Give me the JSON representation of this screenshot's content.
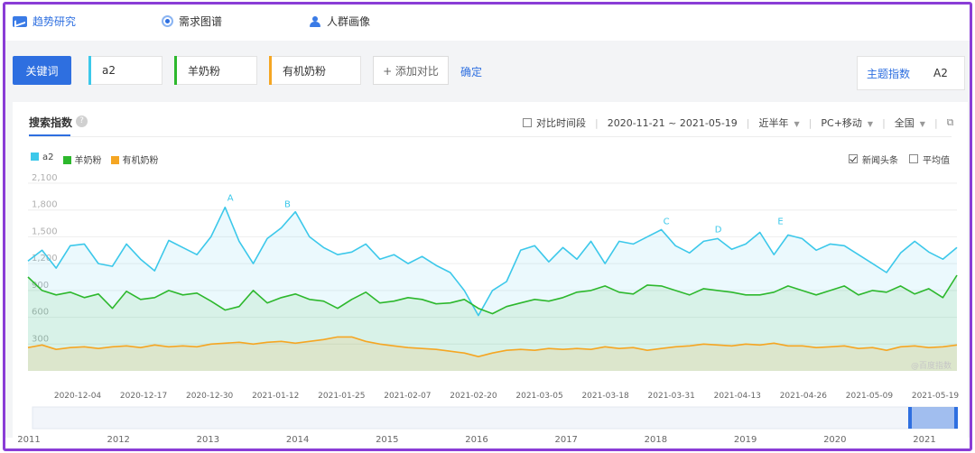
{
  "nav": {
    "trend_research": "趋势研究",
    "demand_map": "需求图谱",
    "crowd_profile": "人群画像"
  },
  "keywords": {
    "button_label": "关键词",
    "items": [
      {
        "text": "a2",
        "color": "#3cc8ea"
      },
      {
        "text": "羊奶粉",
        "color": "#2db82d"
      },
      {
        "text": "有机奶粉",
        "color": "#f5a623"
      }
    ],
    "add_compare": "+ 添加对比",
    "confirm": "确定"
  },
  "topic_index": {
    "label": "主题指数",
    "value": "A2"
  },
  "panel": {
    "title": "搜索指数",
    "compare_period": "对比时间段",
    "date_range": "2020-11-21 ~ 2021-05-19",
    "range_option": "近半年",
    "device": "PC+移动",
    "region": "全国"
  },
  "legend": [
    {
      "name": "a2",
      "color": "#3cc8ea"
    },
    {
      "name": "羊奶粉",
      "color": "#2db82d"
    },
    {
      "name": "有机奶粉",
      "color": "#f5a623"
    }
  ],
  "options": {
    "news_headlines": "新闻头条",
    "average": "平均值"
  },
  "watermark": "@百度指数",
  "chart_data": {
    "type": "line",
    "ylim": [
      0,
      2100
    ],
    "yticks": [
      "300",
      "600",
      "900",
      "1,200",
      "1,500",
      "1,800",
      "2,100"
    ],
    "yticks_values": [
      300,
      600,
      900,
      1200,
      1500,
      1800,
      2100
    ],
    "x_labels": [
      "2020-12-04",
      "2020-12-17",
      "2020-12-30",
      "2021-01-12",
      "2021-01-25",
      "2021-02-07",
      "2021-02-20",
      "2021-03-05",
      "2021-03-18",
      "2021-03-31",
      "2021-04-13",
      "2021-04-26",
      "2021-05-09",
      "2021-05-19"
    ],
    "annotations": [
      {
        "label": "A",
        "date": "2020-12-30",
        "value": 1820
      },
      {
        "label": "B",
        "date": "2021-01-10",
        "value": 1750
      },
      {
        "label": "C",
        "date": "2021-03-24",
        "value": 1560
      },
      {
        "label": "D",
        "date": "2021-04-03",
        "value": 1470
      },
      {
        "label": "E",
        "date": "2021-04-15",
        "value": 1560
      }
    ],
    "series": [
      {
        "name": "a2",
        "color": "#3cc8ea",
        "values": [
          1230,
          1350,
          1150,
          1400,
          1420,
          1200,
          1170,
          1420,
          1250,
          1120,
          1460,
          1380,
          1300,
          1500,
          1830,
          1450,
          1200,
          1480,
          1600,
          1780,
          1500,
          1380,
          1300,
          1330,
          1420,
          1250,
          1300,
          1200,
          1280,
          1180,
          1100,
          900,
          620,
          900,
          1000,
          1350,
          1400,
          1220,
          1380,
          1250,
          1450,
          1200,
          1450,
          1420,
          1500,
          1580,
          1400,
          1320,
          1450,
          1480,
          1360,
          1420,
          1550,
          1300,
          1520,
          1480,
          1350,
          1420,
          1400,
          1300,
          1200,
          1100,
          1320,
          1450,
          1330,
          1250,
          1380
        ]
      },
      {
        "name": "羊奶粉",
        "color": "#2db82d",
        "values": [
          1050,
          900,
          850,
          880,
          820,
          860,
          700,
          890,
          800,
          820,
          900,
          850,
          870,
          780,
          680,
          720,
          900,
          760,
          820,
          860,
          800,
          780,
          700,
          800,
          880,
          760,
          780,
          820,
          800,
          750,
          760,
          800,
          700,
          640,
          720,
          760,
          800,
          780,
          820,
          880,
          900,
          950,
          880,
          860,
          960,
          950,
          900,
          850,
          920,
          900,
          880,
          850,
          850,
          880,
          950,
          900,
          850,
          900,
          950,
          850,
          900,
          880,
          950,
          860,
          920,
          820,
          1070
        ]
      },
      {
        "name": "有机奶粉",
        "color": "#f5a623",
        "values": [
          260,
          290,
          240,
          260,
          270,
          250,
          270,
          280,
          260,
          290,
          270,
          280,
          270,
          300,
          310,
          320,
          300,
          320,
          330,
          310,
          330,
          350,
          380,
          380,
          330,
          300,
          280,
          260,
          250,
          240,
          220,
          200,
          160,
          200,
          230,
          240,
          230,
          250,
          240,
          250,
          240,
          270,
          250,
          260,
          230,
          250,
          270,
          280,
          300,
          290,
          280,
          300,
          290,
          310,
          280,
          280,
          260,
          270,
          280,
          250,
          260,
          230,
          270,
          280,
          260,
          270,
          290
        ]
      }
    ]
  },
  "timeline": {
    "years": [
      "2011",
      "2012",
      "2013",
      "2014",
      "2015",
      "2016",
      "2017",
      "2018",
      "2019",
      "2020",
      "2021"
    ]
  }
}
